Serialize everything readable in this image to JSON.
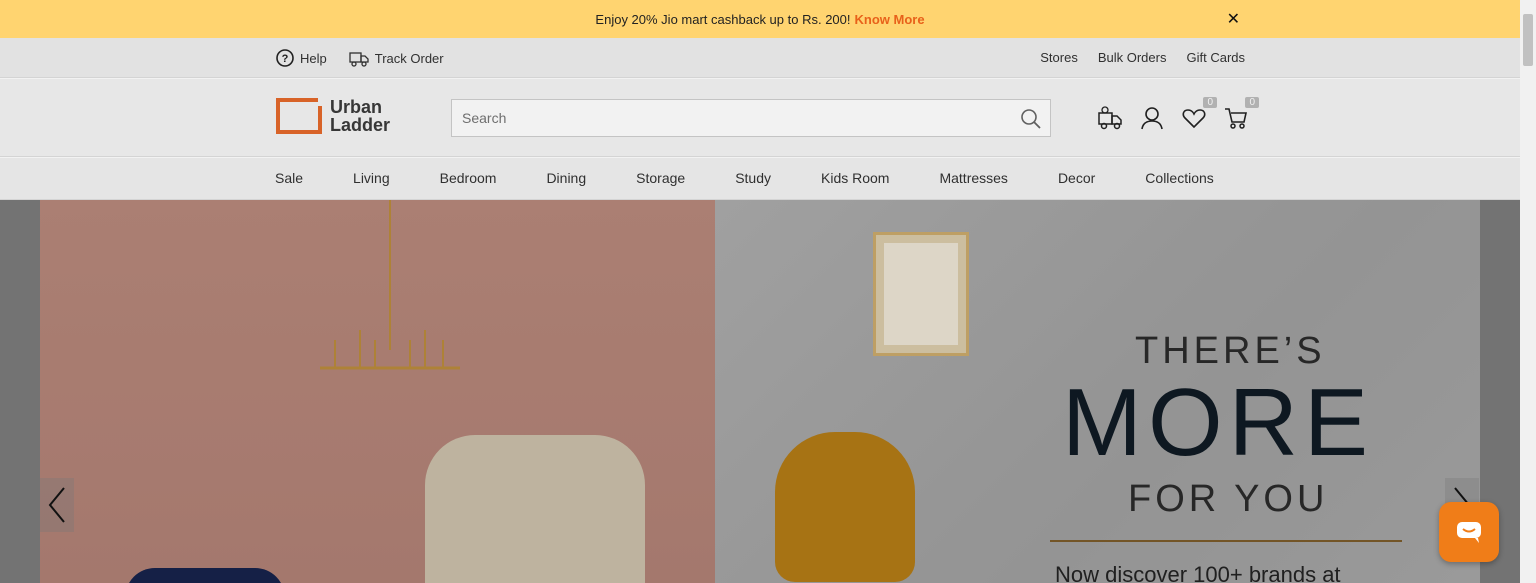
{
  "promo": {
    "text": "Enjoy 20% Jio mart cashback up to Rs. 200!",
    "link": "Know More",
    "close_glyph": "✕"
  },
  "utility": {
    "help": "Help",
    "track_order": "Track Order",
    "stores": "Stores",
    "bulk_orders": "Bulk Orders",
    "gift_cards": "Gift Cards"
  },
  "header": {
    "logo_line1": "Urban",
    "logo_line2": "Ladder",
    "search_placeholder": "Search",
    "wishlist_count": "0",
    "cart_count": "0"
  },
  "nav": {
    "items": [
      "Sale",
      "Living",
      "Bedroom",
      "Dining",
      "Storage",
      "Study",
      "Kids Room",
      "Mattresses",
      "Decor",
      "Collections"
    ]
  },
  "hero": {
    "line1": "THERE’S",
    "line2": "MORE",
    "line3": "FOR YOU",
    "subtitle": "Now discover 100+ brands at"
  },
  "colors": {
    "promo_bg": "#ffd470",
    "accent": "#e8611a",
    "chat": "#f07d18"
  }
}
